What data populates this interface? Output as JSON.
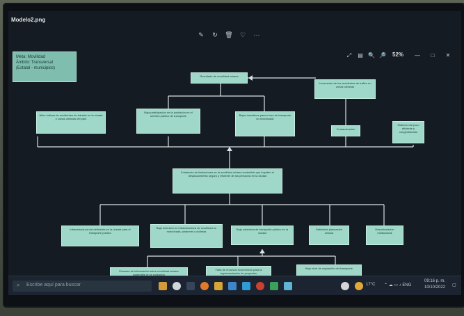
{
  "window": {
    "title": "Modelo2.png",
    "zoom": "52%",
    "toolbar_icons": [
      "edit-icon",
      "rotate-icon",
      "delete-icon",
      "favorite-icon",
      "more-icon"
    ],
    "right_icons": [
      "expand-icon",
      "info-icon",
      "zoom-out-icon",
      "zoom-in-icon"
    ],
    "window_controls": [
      "—",
      "□",
      "✕"
    ]
  },
  "diagram": {
    "legend": "Meta: Movilidad\nÁmbito: Transversal\n(Estatal - municipios)",
    "boxes": {
      "root": "Resultado de movilidad urbana",
      "top_right": "Incremento de los accidentes de tráfico en zonas urbanas",
      "mid_left_1": "Altos índices de accidentes de tránsito en la ciudad y zonas urbanas del país",
      "mid_left_2": "Baja participación de la población en el servicio público de transporte",
      "mid_center": "Bajos incentivos para el uso de transporte no motorizado",
      "mid_right_1": "Contaminación",
      "mid_right_2": "Sistema vial poco eficiente y congestionado",
      "central": "Existencia de limitaciones en la movilidad urbana sostenible que impiden el desplazamiento seguro y eficiente de las personas en la ciudad",
      "c1": "Infraestructura vial deficiente en la ciudad para el transporte público",
      "c2": "Baja inversión en infraestructura de movilidad no motorizada, peatones y ciclistas",
      "c3": "Baja cobertura de transporte público en la ciudad",
      "c4": "Deficiente planeación urbana",
      "c5": "Desarticulación institucional",
      "b1": "Escasez de información sobre movilidad urbana sostenible en la población",
      "b2": "Falta de recursos económicos para la implementación de proyectos",
      "b3": "Bajo nivel de regulación del transporte"
    }
  },
  "taskbar": {
    "search_placeholder": "Escribe aquí para buscar",
    "temperature": "17°C",
    "time": "09:16 p. m.",
    "date": "10/10/2022"
  }
}
